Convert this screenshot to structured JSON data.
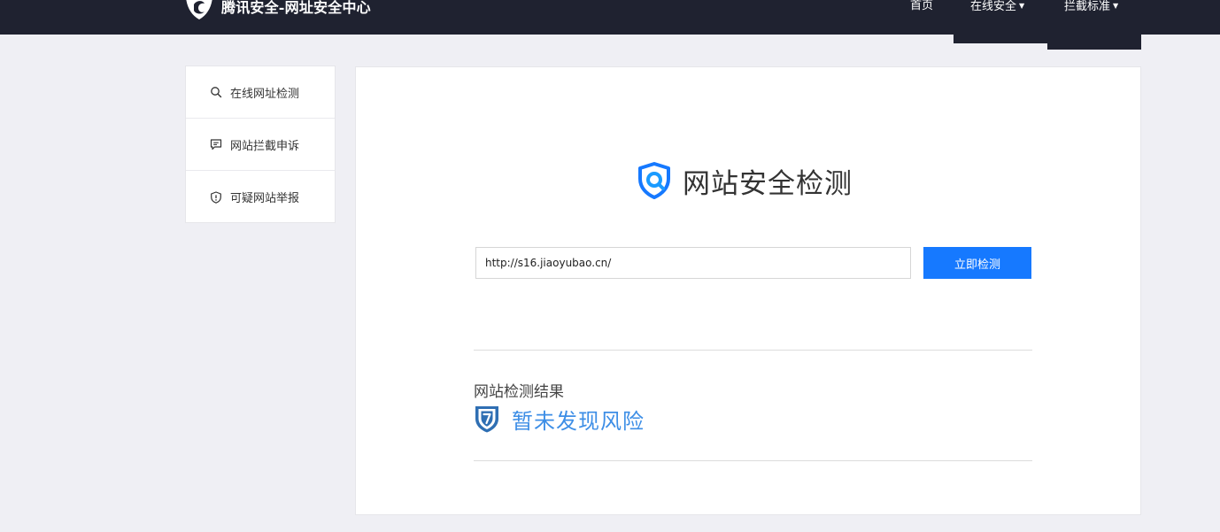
{
  "header": {
    "brand_name": "腾讯安全-网址安全中心",
    "nav": [
      {
        "label": "首页"
      },
      {
        "label": "在线安全",
        "has_dropdown": true
      },
      {
        "label": "拦截标准",
        "has_dropdown": true
      }
    ]
  },
  "sidebar": {
    "items": [
      {
        "label": "在线网址检测",
        "icon": "search-icon"
      },
      {
        "label": "网站拦截申诉",
        "icon": "chat-icon"
      },
      {
        "label": "可疑网站举报",
        "icon": "shield-alert-icon"
      }
    ]
  },
  "main": {
    "title": "网站安全检测",
    "search": {
      "value": "http://s16.jiaoyubao.cn/",
      "placeholder": ""
    },
    "check_button_label": "立即检测",
    "result": {
      "label": "网站检测结果",
      "status": "暂未发现风险",
      "status_icon": "shield-unknown-icon"
    }
  },
  "colors": {
    "topbar_bg": "#1f2230",
    "page_bg": "#efeff4",
    "accent": "#1679ff",
    "status_blue": "#3d8ee6"
  }
}
